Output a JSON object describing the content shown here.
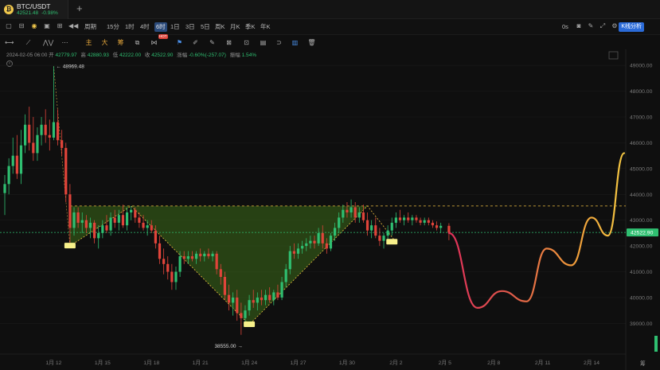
{
  "tab": {
    "coin_glyph": "₿",
    "symbol": "BTC/USDT",
    "price": "42521.48",
    "change": "-0.98%",
    "add": "+"
  },
  "toolbar": {
    "periods": [
      "周期",
      "15分",
      "1时",
      "4时",
      "6时",
      "1日",
      "3日",
      "5日",
      "周K",
      "月K",
      "季K",
      "年K"
    ],
    "active_period": "6时",
    "zero_label": "0s",
    "kline_analysis": "K线分析"
  },
  "drawing_tools": {
    "zhu": "主",
    "da": "大",
    "chou": "筹",
    "hot_badge": "HOT"
  },
  "info": {
    "datetime": "2024-02-05 06:00",
    "open_label": "开",
    "open": "42779.97",
    "high_label": "高",
    "high": "42880.93",
    "low_label": "低",
    "low": "42222.00",
    "close_label": "收",
    "close": "42522.90",
    "change_label": "涨幅",
    "change": "-0.60%(-257.07)",
    "amp_label": "振幅",
    "amp": "1.54%"
  },
  "colors": {
    "up": "#2fbf71",
    "down": "#e0443a",
    "pattern_fill": "#3d6b1a",
    "pattern_edge": "#f0c040",
    "marker": "#f7f08a",
    "price_tag": "#2fbf71"
  },
  "chart_data": {
    "type": "candlestick",
    "y_axis": {
      "ticks": [
        39000,
        40000,
        41000,
        42000,
        43000,
        44000,
        45000,
        46000,
        47000,
        48000,
        49000
      ],
      "tick_labels": [
        "39000.00",
        "40000.00",
        "41000.00",
        "42000.00",
        "43000.00",
        "44000.00",
        "45000.00",
        "46000.00",
        "47000.00",
        "48000.00",
        "49000.00"
      ],
      "range": [
        37900,
        49500
      ]
    },
    "x_axis": {
      "tick_labels": [
        "1月 12",
        "1月 15",
        "1月 18",
        "1月 21",
        "1月 24",
        "1月 27",
        "1月 30",
        "2月 2",
        "2月 5",
        "2月 8",
        "2月 11",
        "2月 14"
      ],
      "start": "2024-01-09",
      "end": "2024-02-16"
    },
    "annotations": {
      "high_label": "← 48969.48",
      "low_label": "38555.00 →",
      "neckline_price": 43550,
      "current_price_label": "42522.90",
      "current_price": 42522.9,
      "right_edge_label": "筹"
    },
    "pattern_points": [
      {
        "date": "2024-01-13 00:00",
        "price": 42000
      },
      {
        "date": "2024-01-16 18:00",
        "price": 43550
      },
      {
        "date": "2024-01-24 00:00",
        "price": 38950
      },
      {
        "date": "2024-01-31 06:00",
        "price": 43550
      },
      {
        "date": "2024-02-02 00:00",
        "price": 42150
      }
    ],
    "marker_prices": [
      {
        "date": "2024-01-13 00:00",
        "price": 42000
      },
      {
        "date": "2024-01-24 00:00",
        "price": 38950
      },
      {
        "date": "2024-02-01 18:00",
        "price": 42150
      }
    ],
    "forecast": {
      "dates": [
        "2024-02-05 06:00",
        "2024-02-07 00:00",
        "2024-02-08 12:00",
        "2024-02-10 00:00",
        "2024-02-11 06:00",
        "2024-02-12 18:00",
        "2024-02-14 00:00",
        "2024-02-15 00:00",
        "2024-02-16 00:00"
      ],
      "prices": [
        42500,
        39600,
        40250,
        39850,
        41900,
        41250,
        43100,
        42400,
        45600
      ]
    },
    "candles": [
      {
        "date": "2024-01-09 00:00",
        "o": 44050,
        "h": 44750,
        "l": 43200,
        "c": 44400
      },
      {
        "date": "2024-01-09 06:00",
        "o": 44400,
        "h": 45400,
        "l": 44000,
        "c": 45100
      },
      {
        "date": "2024-01-09 12:00",
        "o": 45100,
        "h": 46200,
        "l": 44800,
        "c": 45500
      },
      {
        "date": "2024-01-09 18:00",
        "o": 45500,
        "h": 46300,
        "l": 44600,
        "c": 44800
      },
      {
        "date": "2024-01-10 00:00",
        "o": 44800,
        "h": 46500,
        "l": 44400,
        "c": 45900
      },
      {
        "date": "2024-01-10 06:00",
        "o": 45900,
        "h": 47100,
        "l": 45600,
        "c": 46700
      },
      {
        "date": "2024-01-10 12:00",
        "o": 46700,
        "h": 47400,
        "l": 45700,
        "c": 46000
      },
      {
        "date": "2024-01-10 18:00",
        "o": 46000,
        "h": 47000,
        "l": 45300,
        "c": 45600
      },
      {
        "date": "2024-01-11 00:00",
        "o": 45600,
        "h": 46600,
        "l": 45300,
        "c": 46300
      },
      {
        "date": "2024-01-11 06:00",
        "o": 46300,
        "h": 47000,
        "l": 45900,
        "c": 46700
      },
      {
        "date": "2024-01-11 12:00",
        "o": 46700,
        "h": 47300,
        "l": 46000,
        "c": 46300
      },
      {
        "date": "2024-01-11 18:00",
        "o": 46300,
        "h": 46900,
        "l": 45700,
        "c": 46200
      },
      {
        "date": "2024-01-12 00:00",
        "o": 46200,
        "h": 48969.48,
        "l": 46100,
        "c": 46800
      },
      {
        "date": "2024-01-12 06:00",
        "o": 46800,
        "h": 47300,
        "l": 45900,
        "c": 46100
      },
      {
        "date": "2024-01-12 12:00",
        "o": 46100,
        "h": 46500,
        "l": 45500,
        "c": 45800
      },
      {
        "date": "2024-01-12 18:00",
        "o": 45800,
        "h": 46000,
        "l": 43700,
        "c": 44000
      },
      {
        "date": "2024-01-13 00:00",
        "o": 44000,
        "h": 44400,
        "l": 42000,
        "c": 42700
      },
      {
        "date": "2024-01-13 06:00",
        "o": 42700,
        "h": 43500,
        "l": 42400,
        "c": 43300
      },
      {
        "date": "2024-01-13 12:00",
        "o": 43300,
        "h": 43500,
        "l": 42700,
        "c": 42900
      },
      {
        "date": "2024-01-13 18:00",
        "o": 42900,
        "h": 43300,
        "l": 42500,
        "c": 43000
      },
      {
        "date": "2024-01-14 00:00",
        "o": 43000,
        "h": 43200,
        "l": 42500,
        "c": 42700
      },
      {
        "date": "2024-01-14 06:00",
        "o": 42700,
        "h": 43100,
        "l": 42300,
        "c": 42900
      },
      {
        "date": "2024-01-14 12:00",
        "o": 42900,
        "h": 43000,
        "l": 42100,
        "c": 42300
      },
      {
        "date": "2024-01-14 18:00",
        "o": 42300,
        "h": 42800,
        "l": 41900,
        "c": 42500
      },
      {
        "date": "2024-01-15 00:00",
        "o": 42500,
        "h": 43000,
        "l": 42300,
        "c": 42800
      },
      {
        "date": "2024-01-15 06:00",
        "o": 42800,
        "h": 43200,
        "l": 42500,
        "c": 42600
      },
      {
        "date": "2024-01-15 12:00",
        "o": 42600,
        "h": 43300,
        "l": 42400,
        "c": 43100
      },
      {
        "date": "2024-01-15 18:00",
        "o": 43100,
        "h": 43400,
        "l": 42700,
        "c": 42900
      },
      {
        "date": "2024-01-16 00:00",
        "o": 42900,
        "h": 43400,
        "l": 42600,
        "c": 43200
      },
      {
        "date": "2024-01-16 06:00",
        "o": 43200,
        "h": 43600,
        "l": 42700,
        "c": 42800
      },
      {
        "date": "2024-01-16 12:00",
        "o": 42800,
        "h": 43500,
        "l": 42600,
        "c": 43300
      },
      {
        "date": "2024-01-16 18:00",
        "o": 43300,
        "h": 43550,
        "l": 43000,
        "c": 43400
      },
      {
        "date": "2024-01-17 00:00",
        "o": 43400,
        "h": 43500,
        "l": 42900,
        "c": 43100
      },
      {
        "date": "2024-01-17 06:00",
        "o": 43100,
        "h": 43300,
        "l": 42700,
        "c": 42900
      },
      {
        "date": "2024-01-17 12:00",
        "o": 42900,
        "h": 43200,
        "l": 42600,
        "c": 42700
      },
      {
        "date": "2024-01-17 18:00",
        "o": 42700,
        "h": 43000,
        "l": 42400,
        "c": 42800
      },
      {
        "date": "2024-01-18 00:00",
        "o": 42800,
        "h": 43000,
        "l": 42500,
        "c": 42600
      },
      {
        "date": "2024-01-18 06:00",
        "o": 42600,
        "h": 42800,
        "l": 41900,
        "c": 42100
      },
      {
        "date": "2024-01-18 12:00",
        "o": 42100,
        "h": 42400,
        "l": 41300,
        "c": 41500
      },
      {
        "date": "2024-01-18 18:00",
        "o": 41500,
        "h": 41900,
        "l": 40900,
        "c": 41300
      },
      {
        "date": "2024-01-19 00:00",
        "o": 41300,
        "h": 41600,
        "l": 40700,
        "c": 41000
      },
      {
        "date": "2024-01-19 06:00",
        "o": 41000,
        "h": 41300,
        "l": 40300,
        "c": 40600
      },
      {
        "date": "2024-01-19 12:00",
        "o": 40600,
        "h": 41200,
        "l": 40300,
        "c": 41000
      },
      {
        "date": "2024-01-19 18:00",
        "o": 41000,
        "h": 41800,
        "l": 40800,
        "c": 41600
      },
      {
        "date": "2024-01-20 00:00",
        "o": 41600,
        "h": 41800,
        "l": 41300,
        "c": 41500
      },
      {
        "date": "2024-01-20 06:00",
        "o": 41500,
        "h": 41800,
        "l": 41300,
        "c": 41600
      },
      {
        "date": "2024-01-20 12:00",
        "o": 41600,
        "h": 41800,
        "l": 41400,
        "c": 41500
      },
      {
        "date": "2024-01-20 18:00",
        "o": 41500,
        "h": 41800,
        "l": 41300,
        "c": 41700
      },
      {
        "date": "2024-01-21 00:00",
        "o": 41700,
        "h": 41900,
        "l": 41400,
        "c": 41600
      },
      {
        "date": "2024-01-21 06:00",
        "o": 41600,
        "h": 41800,
        "l": 41400,
        "c": 41700
      },
      {
        "date": "2024-01-21 12:00",
        "o": 41700,
        "h": 41900,
        "l": 41500,
        "c": 41600
      },
      {
        "date": "2024-01-21 18:00",
        "o": 41600,
        "h": 41800,
        "l": 41400,
        "c": 41700
      },
      {
        "date": "2024-01-22 00:00",
        "o": 41700,
        "h": 41800,
        "l": 40900,
        "c": 41100
      },
      {
        "date": "2024-01-22 06:00",
        "o": 41100,
        "h": 41300,
        "l": 40500,
        "c": 40800
      },
      {
        "date": "2024-01-22 12:00",
        "o": 40800,
        "h": 41000,
        "l": 39900,
        "c": 40100
      },
      {
        "date": "2024-01-22 18:00",
        "o": 40100,
        "h": 40500,
        "l": 39500,
        "c": 39800
      },
      {
        "date": "2024-01-23 00:00",
        "o": 39800,
        "h": 40200,
        "l": 39300,
        "c": 40000
      },
      {
        "date": "2024-01-23 06:00",
        "o": 40000,
        "h": 40300,
        "l": 39100,
        "c": 39400
      },
      {
        "date": "2024-01-23 12:00",
        "o": 39400,
        "h": 39800,
        "l": 38555,
        "c": 39200
      },
      {
        "date": "2024-01-23 18:00",
        "o": 39200,
        "h": 39700,
        "l": 38900,
        "c": 39500
      },
      {
        "date": "2024-01-24 00:00",
        "o": 39500,
        "h": 40100,
        "l": 39300,
        "c": 39900
      },
      {
        "date": "2024-01-24 06:00",
        "o": 39900,
        "h": 40300,
        "l": 39600,
        "c": 39800
      },
      {
        "date": "2024-01-24 12:00",
        "o": 39800,
        "h": 40200,
        "l": 39500,
        "c": 40000
      },
      {
        "date": "2024-01-24 18:00",
        "o": 40000,
        "h": 40300,
        "l": 39700,
        "c": 39900
      },
      {
        "date": "2024-01-25 00:00",
        "o": 39900,
        "h": 40300,
        "l": 39700,
        "c": 40100
      },
      {
        "date": "2024-01-25 06:00",
        "o": 40100,
        "h": 40400,
        "l": 39800,
        "c": 39900
      },
      {
        "date": "2024-01-25 12:00",
        "o": 39900,
        "h": 40300,
        "l": 39700,
        "c": 40200
      },
      {
        "date": "2024-01-25 18:00",
        "o": 40200,
        "h": 40500,
        "l": 39900,
        "c": 40000
      },
      {
        "date": "2024-01-26 00:00",
        "o": 40000,
        "h": 40800,
        "l": 39900,
        "c": 40600
      },
      {
        "date": "2024-01-26 06:00",
        "o": 40600,
        "h": 41300,
        "l": 40400,
        "c": 41100
      },
      {
        "date": "2024-01-26 12:00",
        "o": 41100,
        "h": 42000,
        "l": 40900,
        "c": 41800
      },
      {
        "date": "2024-01-26 18:00",
        "o": 41800,
        "h": 42100,
        "l": 41500,
        "c": 41700
      },
      {
        "date": "2024-01-27 00:00",
        "o": 41700,
        "h": 42100,
        "l": 41500,
        "c": 41900
      },
      {
        "date": "2024-01-27 06:00",
        "o": 41900,
        "h": 42200,
        "l": 41700,
        "c": 42000
      },
      {
        "date": "2024-01-27 12:00",
        "o": 42000,
        "h": 42300,
        "l": 41800,
        "c": 42100
      },
      {
        "date": "2024-01-27 18:00",
        "o": 42100,
        "h": 42400,
        "l": 41900,
        "c": 42200
      },
      {
        "date": "2024-01-28 00:00",
        "o": 42200,
        "h": 42400,
        "l": 41900,
        "c": 42100
      },
      {
        "date": "2024-01-28 06:00",
        "o": 42100,
        "h": 42700,
        "l": 42000,
        "c": 42500
      },
      {
        "date": "2024-01-28 12:00",
        "o": 42500,
        "h": 42800,
        "l": 41900,
        "c": 42100
      },
      {
        "date": "2024-01-28 18:00",
        "o": 42100,
        "h": 42300,
        "l": 41700,
        "c": 41900
      },
      {
        "date": "2024-01-29 00:00",
        "o": 41900,
        "h": 42500,
        "l": 41800,
        "c": 42400
      },
      {
        "date": "2024-01-29 06:00",
        "o": 42400,
        "h": 42900,
        "l": 42200,
        "c": 42700
      },
      {
        "date": "2024-01-29 12:00",
        "o": 42700,
        "h": 43300,
        "l": 42500,
        "c": 43100
      },
      {
        "date": "2024-01-29 18:00",
        "o": 43100,
        "h": 43600,
        "l": 42900,
        "c": 43400
      },
      {
        "date": "2024-01-30 00:00",
        "o": 43400,
        "h": 43700,
        "l": 43100,
        "c": 43300
      },
      {
        "date": "2024-01-30 06:00",
        "o": 43300,
        "h": 43800,
        "l": 43100,
        "c": 43500
      },
      {
        "date": "2024-01-30 12:00",
        "o": 43500,
        "h": 43700,
        "l": 42900,
        "c": 43100
      },
      {
        "date": "2024-01-30 18:00",
        "o": 43100,
        "h": 43500,
        "l": 42900,
        "c": 43300
      },
      {
        "date": "2024-01-31 00:00",
        "o": 43300,
        "h": 43600,
        "l": 42900,
        "c": 43000
      },
      {
        "date": "2024-01-31 06:00",
        "o": 43000,
        "h": 43300,
        "l": 42400,
        "c": 42600
      },
      {
        "date": "2024-01-31 12:00",
        "o": 42600,
        "h": 43000,
        "l": 42300,
        "c": 42800
      },
      {
        "date": "2024-01-31 18:00",
        "o": 42800,
        "h": 43100,
        "l": 42300,
        "c": 42400
      },
      {
        "date": "2024-02-01 00:00",
        "o": 42400,
        "h": 42700,
        "l": 42000,
        "c": 42200
      },
      {
        "date": "2024-02-01 06:00",
        "o": 42200,
        "h": 42500,
        "l": 41900,
        "c": 42400
      },
      {
        "date": "2024-02-01 12:00",
        "o": 42400,
        "h": 42800,
        "l": 42200,
        "c": 42600
      },
      {
        "date": "2024-02-01 18:00",
        "o": 42600,
        "h": 43100,
        "l": 42400,
        "c": 42900
      },
      {
        "date": "2024-02-02 00:00",
        "o": 42900,
        "h": 43300,
        "l": 42700,
        "c": 43100
      },
      {
        "date": "2024-02-02 06:00",
        "o": 43100,
        "h": 43400,
        "l": 42900,
        "c": 43000
      },
      {
        "date": "2024-02-02 12:00",
        "o": 43000,
        "h": 43200,
        "l": 42800,
        "c": 43100
      },
      {
        "date": "2024-02-02 18:00",
        "o": 43100,
        "h": 43300,
        "l": 42900,
        "c": 43000
      },
      {
        "date": "2024-02-03 00:00",
        "o": 43000,
        "h": 43200,
        "l": 42800,
        "c": 43100
      },
      {
        "date": "2024-02-03 06:00",
        "o": 43100,
        "h": 43200,
        "l": 42900,
        "c": 43000
      },
      {
        "date": "2024-02-03 12:00",
        "o": 43000,
        "h": 43100,
        "l": 42800,
        "c": 42900
      },
      {
        "date": "2024-02-03 18:00",
        "o": 42900,
        "h": 43100,
        "l": 42800,
        "c": 43000
      },
      {
        "date": "2024-02-04 00:00",
        "o": 43000,
        "h": 43100,
        "l": 42800,
        "c": 42900
      },
      {
        "date": "2024-02-04 06:00",
        "o": 42900,
        "h": 43000,
        "l": 42700,
        "c": 42800
      },
      {
        "date": "2024-02-04 12:00",
        "o": 42800,
        "h": 42950,
        "l": 42600,
        "c": 42700
      },
      {
        "date": "2024-02-04 18:00",
        "o": 42700,
        "h": 42900,
        "l": 42500,
        "c": 42780
      },
      {
        "date": "2024-02-05 06:00",
        "o": 42779.97,
        "h": 42880.93,
        "l": 42222,
        "c": 42522.9
      }
    ]
  }
}
